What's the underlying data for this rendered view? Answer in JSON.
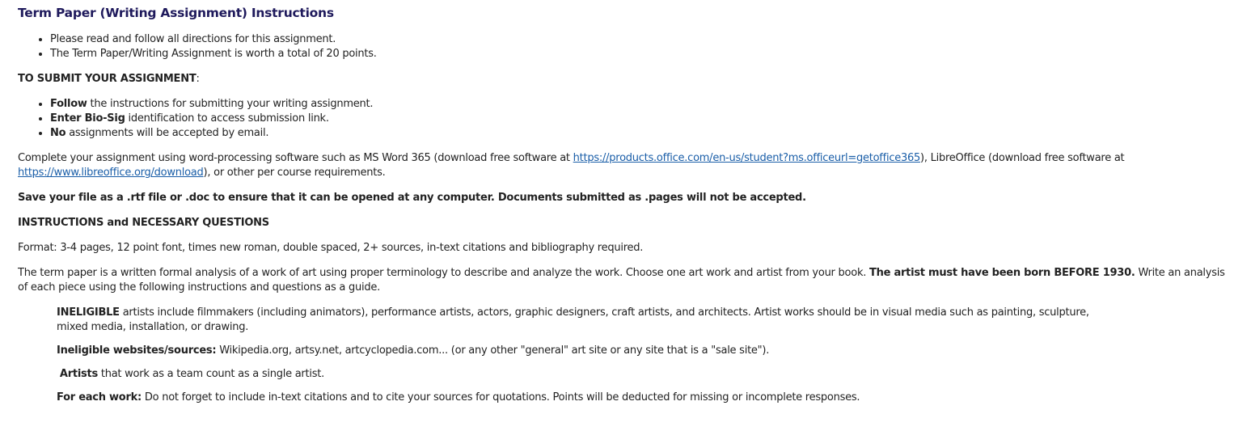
{
  "title": "Term Paper (Writing Assignment) Instructions",
  "intro_items": [
    "Please read and follow all directions for this assignment.",
    "The Term Paper/Writing Assignment is worth a total of 20 points."
  ],
  "submit": {
    "heading": "TO SUBMIT YOUR ASSIGNMENT",
    "heading_colon": ":",
    "items": [
      {
        "bold": "Follow",
        "rest": " the instructions for submitting your writing assignment."
      },
      {
        "bold": "Enter Bio-Sig",
        "rest": " identification to access submission link."
      },
      {
        "bold": "No",
        "rest": " assignments will be accepted by email."
      }
    ]
  },
  "software": {
    "text1": "Complete your assignment using word-processing software such as MS Word 365 (download free software at ",
    "link1": "https://products.office.com/en-us/student?ms.officeurl=getoffice365",
    "text2": "), LibreOffice (download free software at ",
    "link2": "https://www.libreoffice.org/download",
    "text3": "), or other per course requirements."
  },
  "save_note": "Save your file as a .rtf file or .doc to ensure that it can be opened at any computer. Documents submitted as .pages will not be accepted.",
  "instructions_heading": "INSTRUCTIONS and NECESSARY QUESTIONS",
  "format": "Format: 3-4 pages, 12 point font, times new roman, double spaced, 2+ sources, in-text citations and bibliography required.",
  "analysis": {
    "text1": "The term paper is a written formal analysis of a work of art using proper terminology to describe and analyze the work. Choose one art work and artist from your book. ",
    "bold": "The artist must have been born BEFORE 1930.",
    "text2": " Write an analysis of each piece using the following instructions and questions as a guide."
  },
  "rules": {
    "ineligible_bold": "INELIGIBLE",
    "ineligible_rest": " artists include filmmakers (including animators), performance artists, actors, graphic designers, craft artists, and architects. Artist works should be in visual media such as painting, sculpture, mixed media, installation, or drawing.",
    "websites_bold": "Ineligible websites/sources:",
    "websites_rest": " Wikipedia.org, artsy.net, artcyclopedia.com... (or any other \"general\" art site or any site that is a \"sale site\").",
    "artists_bold": "Artists",
    "artists_rest": " that work as a team count as a single artist.",
    "each_bold": "For each work:",
    "each_rest": " Do not forget to include in-text citations and to cite your sources for quotations. Points will be deducted for missing or incomplete responses."
  }
}
